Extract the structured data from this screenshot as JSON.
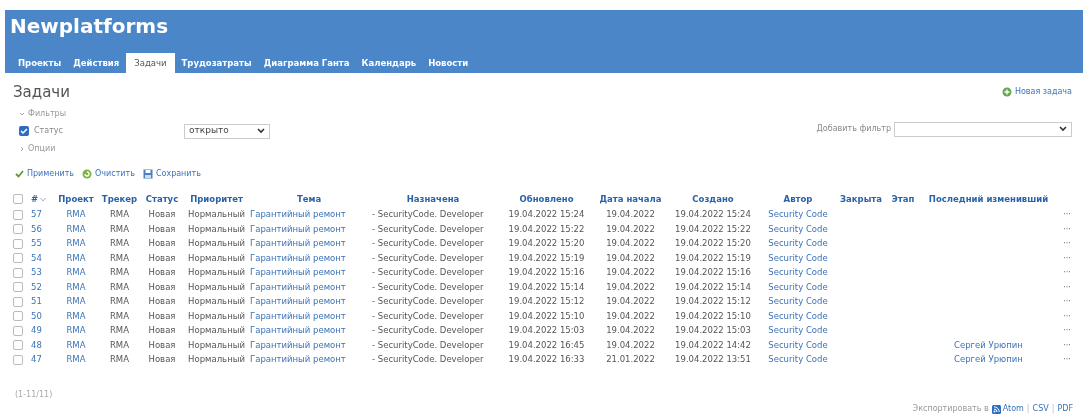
{
  "header": {
    "title": "Newplatforms"
  },
  "tabs": [
    {
      "label": "Проекты",
      "selected": false
    },
    {
      "label": "Действия",
      "selected": false
    },
    {
      "label": "Задачи",
      "selected": true
    },
    {
      "label": "Трудозатраты",
      "selected": false
    },
    {
      "label": "Диаграмма Ганта",
      "selected": false
    },
    {
      "label": "Календарь",
      "selected": false
    },
    {
      "label": "Новости",
      "selected": false
    }
  ],
  "page_title": "Задачи",
  "new_issue": "Новая задача",
  "filters": {
    "legend": "Фильтры",
    "expanded": true,
    "status_label": "Статус",
    "status_checked": true,
    "status_value": "открыто",
    "add_filter_label": "Добавить фильтр"
  },
  "options": {
    "legend": "Опции",
    "expanded": false
  },
  "actions": [
    {
      "kind": "apply",
      "label": "Применить"
    },
    {
      "kind": "clear",
      "label": "Очистить"
    },
    {
      "kind": "save",
      "label": "Сохранить"
    }
  ],
  "table": {
    "select_all_checked": false,
    "columns": [
      {
        "label": "#",
        "sorted": true
      },
      {
        "label": "Проект",
        "sorted": false
      },
      {
        "label": "Трекер",
        "sorted": false
      },
      {
        "label": "Статус",
        "sorted": false
      },
      {
        "label": "Приоритет",
        "sorted": false
      },
      {
        "label": "Тема",
        "sorted": false
      },
      {
        "label": "Назначена",
        "sorted": false
      },
      {
        "label": "Обновлено",
        "sorted": false
      },
      {
        "label": "Дата начала",
        "sorted": false
      },
      {
        "label": "Создано",
        "sorted": false
      },
      {
        "label": "Автор",
        "sorted": false
      },
      {
        "label": "Закрыта",
        "sorted": false
      },
      {
        "label": "Этап",
        "sorted": false
      },
      {
        "label": "Последний изменивший",
        "sorted": false
      }
    ],
    "rows": [
      {
        "checked": false,
        "id": "57",
        "project": "RMA",
        "tracker": "RMA",
        "status": "Новая",
        "priority": "Нормальный",
        "subject": "Гарантийный ремонт",
        "assignee": "- SecurityCode. Developer",
        "updated": "19.04.2022 15:24",
        "start": "19.04.2022",
        "created": "19.04.2022 15:24",
        "author": "Security Code",
        "menu": "···"
      },
      {
        "checked": false,
        "id": "56",
        "project": "RMA",
        "tracker": "RMA",
        "status": "Новая",
        "priority": "Нормальный",
        "subject": "Гарантийный ремонт",
        "assignee": "- SecurityCode. Developer",
        "updated": "19.04.2022 15:22",
        "start": "19.04.2022",
        "created": "19.04.2022 15:22",
        "author": "Security Code",
        "menu": "···"
      },
      {
        "checked": false,
        "id": "55",
        "project": "RMA",
        "tracker": "RMA",
        "status": "Новая",
        "priority": "Нормальный",
        "subject": "Гарантийный ремонт",
        "assignee": "- SecurityCode. Developer",
        "updated": "19.04.2022 15:20",
        "start": "19.04.2022",
        "created": "19.04.2022 15:20",
        "author": "Security Code",
        "menu": "···"
      },
      {
        "checked": false,
        "id": "54",
        "project": "RMA",
        "tracker": "RMA",
        "status": "Новая",
        "priority": "Нормальный",
        "subject": "Гарантийный ремонт",
        "assignee": "- SecurityCode. Developer",
        "updated": "19.04.2022 15:19",
        "start": "19.04.2022",
        "created": "19.04.2022 15:19",
        "author": "Security Code",
        "menu": "···"
      },
      {
        "checked": false,
        "id": "53",
        "project": "RMA",
        "tracker": "RMA",
        "status": "Новая",
        "priority": "Нормальный",
        "subject": "Гарантийный ремонт",
        "assignee": "- SecurityCode. Developer",
        "updated": "19.04.2022 15:16",
        "start": "19.04.2022",
        "created": "19.04.2022 15:16",
        "author": "Security Code",
        "menu": "···"
      },
      {
        "checked": false,
        "id": "52",
        "project": "RMA",
        "tracker": "RMA",
        "status": "Новая",
        "priority": "Нормальный",
        "subject": "Гарантийный ремонт",
        "assignee": "- SecurityCode. Developer",
        "updated": "19.04.2022 15:14",
        "start": "19.04.2022",
        "created": "19.04.2022 15:14",
        "author": "Security Code",
        "menu": "···"
      },
      {
        "checked": false,
        "id": "51",
        "project": "RMA",
        "tracker": "RMA",
        "status": "Новая",
        "priority": "Нормальный",
        "subject": "Гарантийный ремонт",
        "assignee": "- SecurityCode. Developer",
        "updated": "19.04.2022 15:12",
        "start": "19.04.2022",
        "created": "19.04.2022 15:12",
        "author": "Security Code",
        "menu": "···"
      },
      {
        "checked": false,
        "id": "50",
        "project": "RMA",
        "tracker": "RMA",
        "status": "Новая",
        "priority": "Нормальный",
        "subject": "Гарантийный ремонт",
        "assignee": "- SecurityCode. Developer",
        "updated": "19.04.2022 15:10",
        "start": "19.04.2022",
        "created": "19.04.2022 15:10",
        "author": "Security Code",
        "menu": "···"
      },
      {
        "checked": false,
        "id": "49",
        "project": "RMA",
        "tracker": "RMA",
        "status": "Новая",
        "priority": "Нормальный",
        "subject": "Гарантийный ремонт",
        "assignee": "- SecurityCode. Developer",
        "updated": "19.04.2022 15:03",
        "start": "19.04.2022",
        "created": "19.04.2022 15:03",
        "author": "Security Code",
        "menu": "···"
      },
      {
        "checked": false,
        "id": "48",
        "project": "RMA",
        "tracker": "RMA",
        "status": "Новая",
        "priority": "Нормальный",
        "subject": "Гарантийный ремонт",
        "assignee": "- SecurityCode. Developer",
        "updated": "19.04.2022 16:45",
        "start": "19.04.2022",
        "created": "19.04.2022 14:42",
        "author": "Security Code",
        "last_changed_by": "Сергей Урюпин",
        "menu": "···"
      },
      {
        "checked": false,
        "id": "47",
        "project": "RMA",
        "tracker": "RMA",
        "status": "Новая",
        "priority": "Нормальный",
        "subject": "Гарантийный ремонт",
        "assignee": "- SecurityCode. Developer",
        "updated": "19.04.2022 16:33",
        "start": "21.01.2022",
        "created": "19.04.2022 13:51",
        "author": "Security Code",
        "last_changed_by": "Сергей Урюпин",
        "menu": "···"
      }
    ]
  },
  "pagination": "(1-11/11)",
  "export": {
    "label": "Экспортировать в",
    "formats": [
      "Atom",
      "CSV",
      "PDF"
    ],
    "separator": "|"
  }
}
